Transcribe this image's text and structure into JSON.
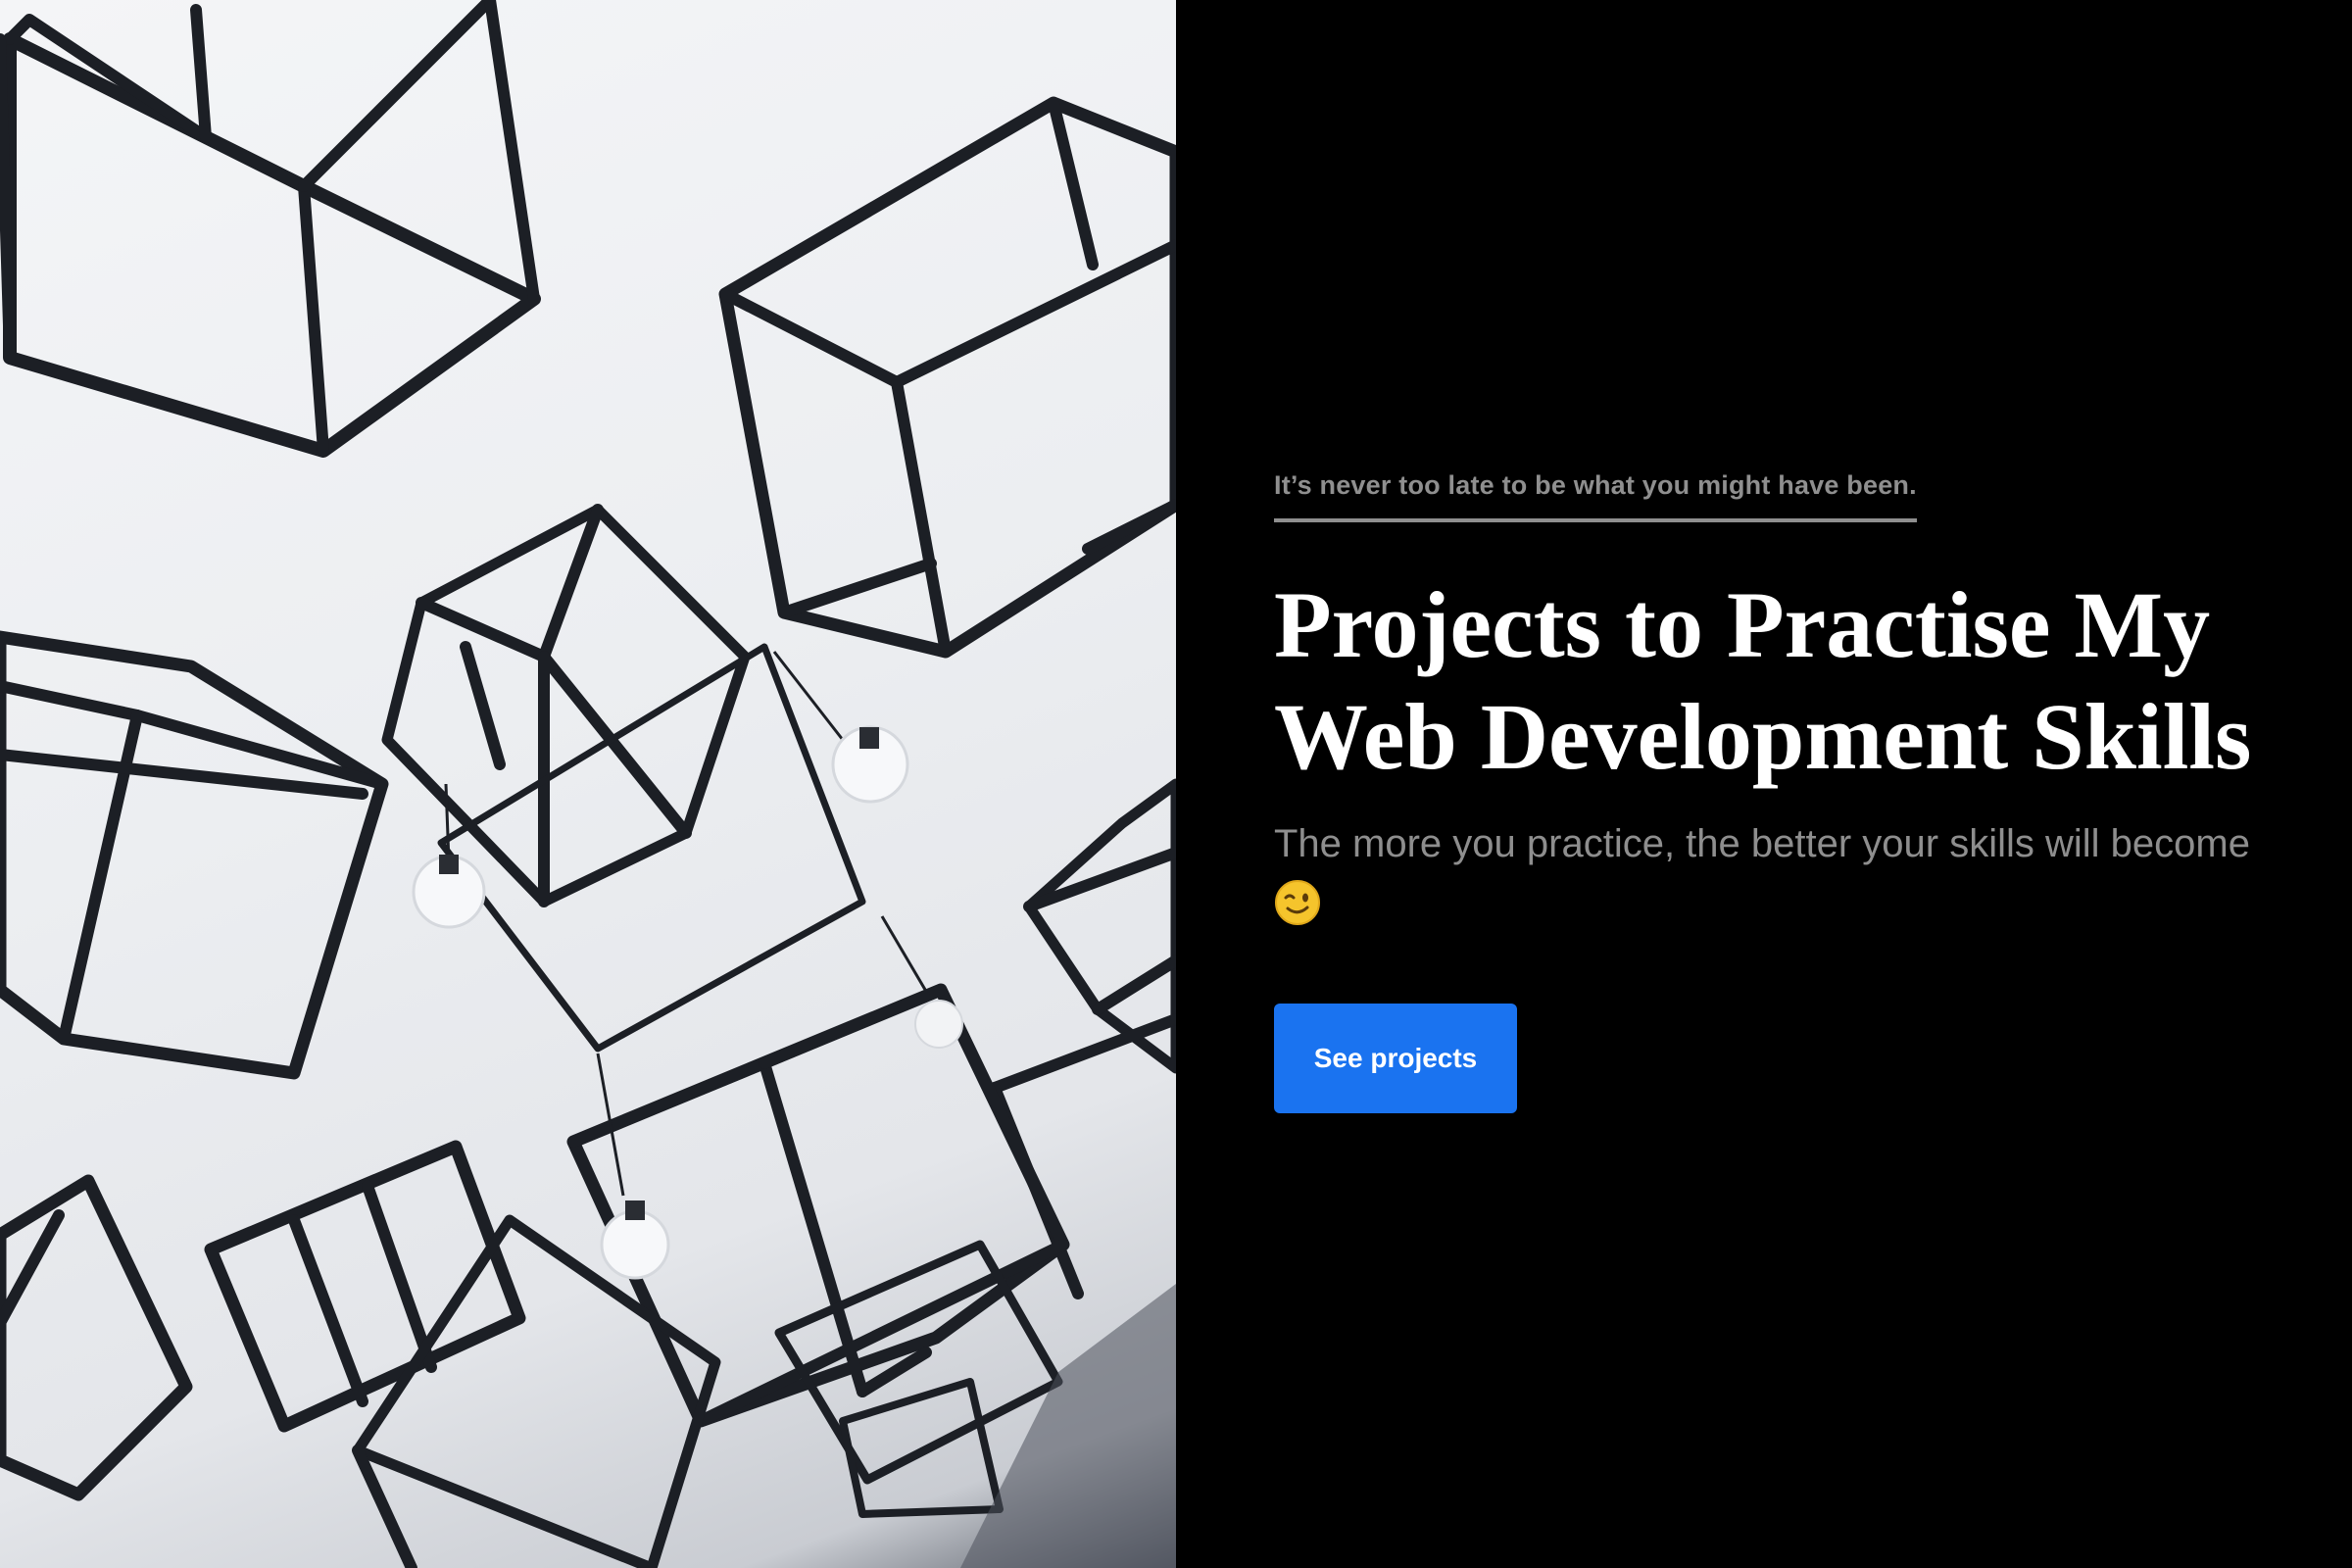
{
  "hero": {
    "image_description_icon": "hanging-wireframe-cubes-image"
  },
  "content": {
    "tagline": "It’s never too late to be what you might have been.",
    "headline": "Projects to Practise My Web Development Skills",
    "subtitle": "The more you practice, the better your skills will become",
    "subtitle_emoji_icon": "winking-face-icon",
    "cta_label": "See projects"
  },
  "colors": {
    "background": "#000000",
    "headline": "#ffffff",
    "muted_text": "#8f8f8f",
    "accent": "#1a73f0"
  }
}
